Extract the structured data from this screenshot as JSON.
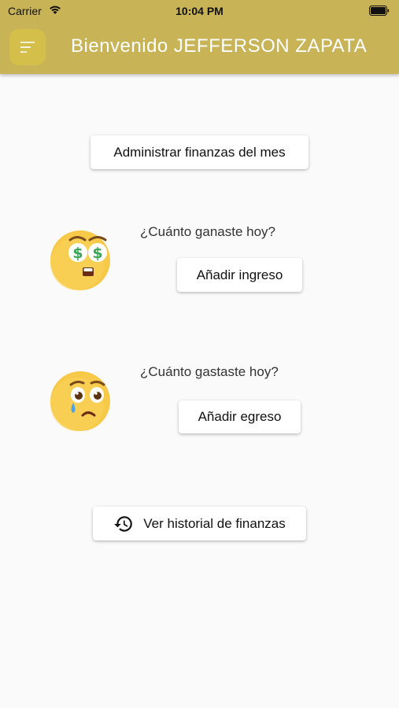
{
  "status_bar": {
    "carrier": "Carrier",
    "time": "10:04 PM"
  },
  "header": {
    "title": "Bienvenido JEFFERSON ZAPATA",
    "menu_icon": "menu-icon"
  },
  "main": {
    "admin_button": "Administrar finanzas del mes",
    "income": {
      "question": "¿Cuánto ganaste hoy?",
      "button": "Añadir ingreso",
      "emoji": "money-eyes-emoji"
    },
    "expense": {
      "question": "¿Cuánto gastaste hoy?",
      "button": "Añadir egreso",
      "emoji": "sad-tear-emoji"
    },
    "history_button": "Ver historial de finanzas",
    "history_icon": "history-icon"
  },
  "colors": {
    "app_bar": "#c8b357",
    "menu_button": "#d4bf4a",
    "background": "#fafafa",
    "emoji_yellow": "#f7c948"
  }
}
